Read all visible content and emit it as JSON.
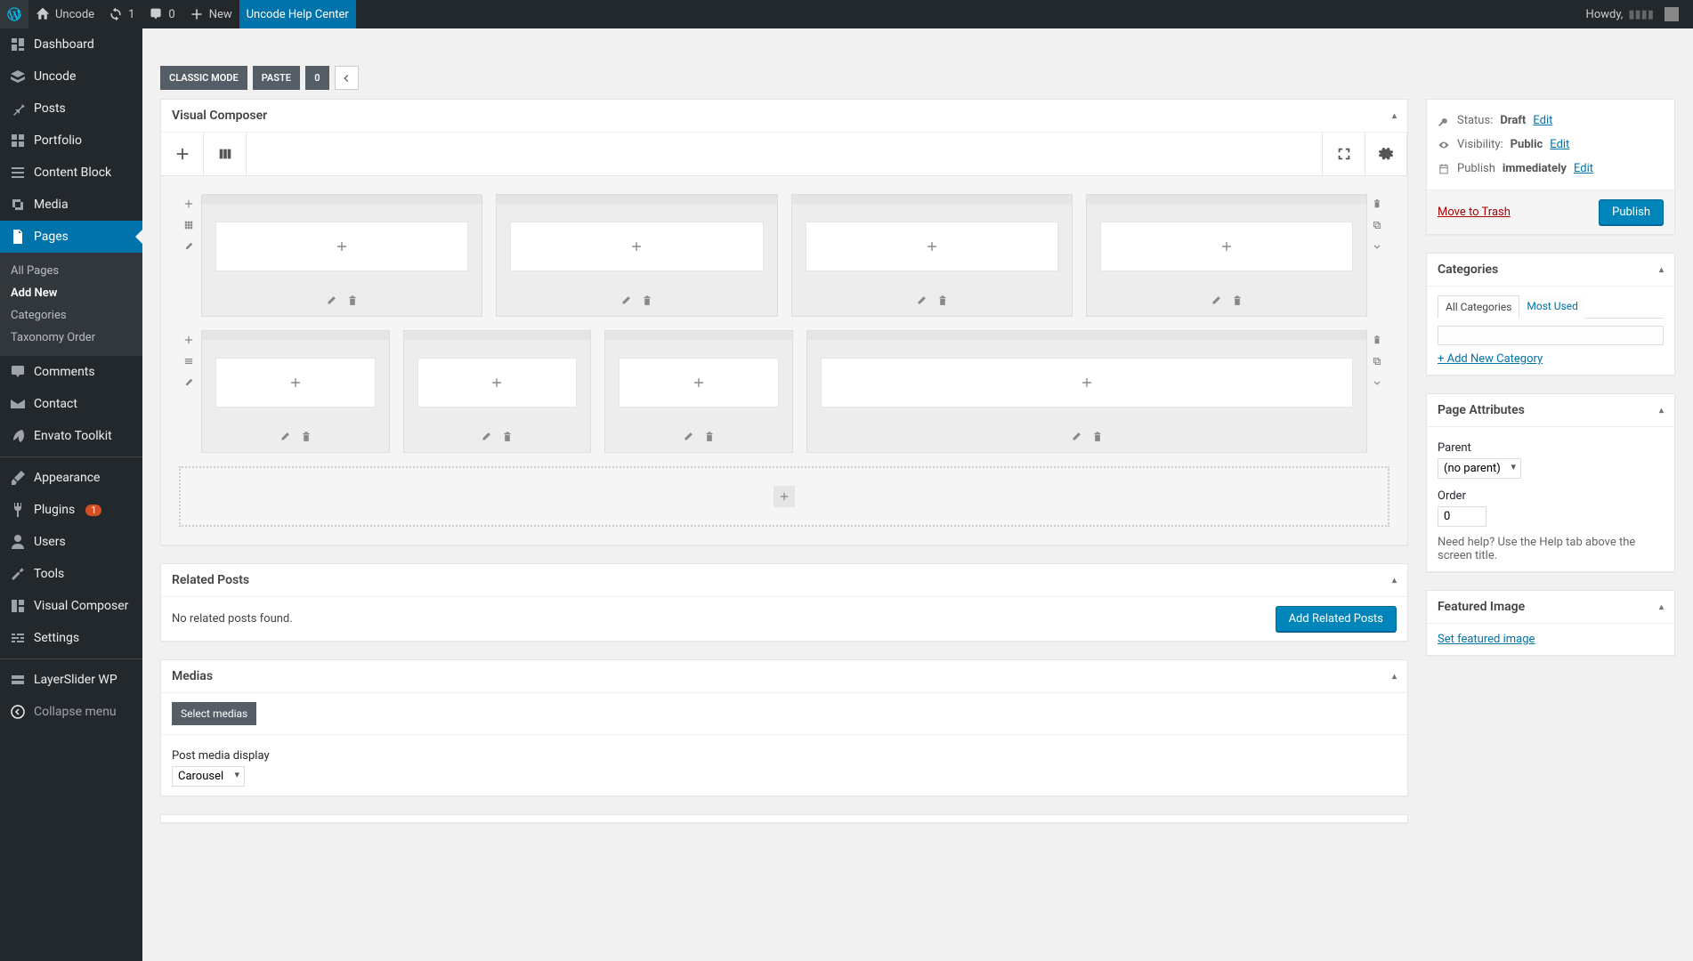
{
  "adminbar": {
    "site_name": "Uncode",
    "refresh_count": "1",
    "comments_count": "0",
    "new_label": "New",
    "help_center": "Uncode Help Center",
    "howdy": "Howdy,"
  },
  "sidebar": {
    "items": [
      {
        "key": "dashboard",
        "label": "Dashboard"
      },
      {
        "key": "uncode",
        "label": "Uncode"
      },
      {
        "key": "posts",
        "label": "Posts"
      },
      {
        "key": "portfolio",
        "label": "Portfolio"
      },
      {
        "key": "content-block",
        "label": "Content Block"
      },
      {
        "key": "media",
        "label": "Media"
      },
      {
        "key": "pages",
        "label": "Pages",
        "active": true
      },
      {
        "key": "comments",
        "label": "Comments"
      },
      {
        "key": "contact",
        "label": "Contact"
      },
      {
        "key": "envato",
        "label": "Envato Toolkit"
      },
      {
        "key": "appearance",
        "label": "Appearance"
      },
      {
        "key": "plugins",
        "label": "Plugins",
        "badge": "1"
      },
      {
        "key": "users",
        "label": "Users"
      },
      {
        "key": "tools",
        "label": "Tools"
      },
      {
        "key": "visual-composer",
        "label": "Visual Composer"
      },
      {
        "key": "settings",
        "label": "Settings"
      },
      {
        "key": "layerslider",
        "label": "LayerSlider WP"
      },
      {
        "key": "collapse",
        "label": "Collapse menu"
      }
    ],
    "pages_sub": [
      {
        "key": "all-pages",
        "label": "All Pages"
      },
      {
        "key": "add-new",
        "label": "Add New",
        "active": true
      },
      {
        "key": "categories",
        "label": "Categories"
      },
      {
        "key": "taxonomy-order",
        "label": "Taxonomy Order"
      }
    ]
  },
  "topcontrols": {
    "classic_mode": "CLASSIC MODE",
    "paste": "PASTE",
    "zero": "0"
  },
  "vc": {
    "title": "Visual Composer"
  },
  "related_posts": {
    "title": "Related Posts",
    "empty_msg": "No related posts found.",
    "add_btn": "Add Related Posts"
  },
  "medias": {
    "title": "Medias",
    "select_btn": "Select medias",
    "display_label": "Post media display",
    "display_value": "Carousel"
  },
  "publish": {
    "status_label": "Status:",
    "status_value": "Draft",
    "visibility_label": "Visibility:",
    "visibility_value": "Public",
    "publish_label": "Publish",
    "publish_value": "immediately",
    "edit": "Edit",
    "trash": "Move to Trash",
    "publish_btn": "Publish"
  },
  "categories_box": {
    "title": "Categories",
    "tab_all": "All Categories",
    "tab_most": "Most Used",
    "add_new": "+ Add New Category"
  },
  "page_attributes": {
    "title": "Page Attributes",
    "parent_label": "Parent",
    "parent_value": "(no parent)",
    "order_label": "Order",
    "order_value": "0",
    "help_text": "Need help? Use the Help tab above the screen title."
  },
  "featured_image": {
    "title": "Featured Image",
    "set_link": "Set featured image"
  }
}
